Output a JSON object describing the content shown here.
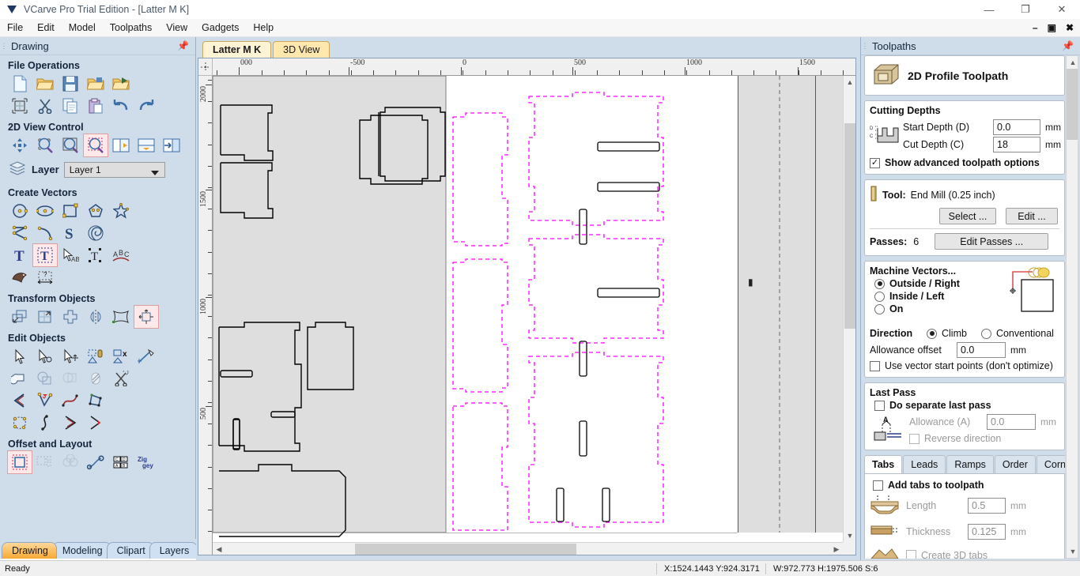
{
  "window": {
    "title": "VCarve Pro Trial Edition - [Latter M K]",
    "logo_icon": "vcarve-logo-icon",
    "minimize_label": "—",
    "maximize_label": "❐",
    "close_label": "✕",
    "mdi_minimize_label": "–",
    "mdi_restore_label": "❐",
    "mdi_close_label": "✖"
  },
  "menu": {
    "items": [
      {
        "label": "File",
        "name": "menu-file"
      },
      {
        "label": "Edit",
        "name": "menu-edit"
      },
      {
        "label": "Model",
        "name": "menu-model"
      },
      {
        "label": "Toolpaths",
        "name": "menu-toolpaths"
      },
      {
        "label": "View",
        "name": "menu-view"
      },
      {
        "label": "Gadgets",
        "name": "menu-gadgets"
      },
      {
        "label": "Help",
        "name": "menu-help"
      }
    ]
  },
  "drawing_panel": {
    "title": "Drawing",
    "pin_icon": "pin-icon",
    "groups": [
      {
        "title": "File Operations"
      },
      {
        "title": "2D View Control"
      },
      {
        "title": "Create Vectors"
      },
      {
        "title": "Transform Objects"
      },
      {
        "title": "Edit Objects"
      },
      {
        "title": "Offset and Layout"
      }
    ],
    "layer": {
      "label": "Layer",
      "value": "Layer 1",
      "icon": "layers-icon"
    },
    "tabs": [
      {
        "label": "Drawing",
        "active": true
      },
      {
        "label": "Modeling",
        "active": false
      },
      {
        "label": "Clipart",
        "active": false
      },
      {
        "label": "Layers",
        "active": false
      }
    ]
  },
  "canvas": {
    "tabs": [
      {
        "label": "Latter M K",
        "active": true
      },
      {
        "label": "3D View",
        "active": false
      }
    ],
    "h_ruler_labels": [
      "000",
      "-500",
      "0",
      "500",
      "1000",
      "1500"
    ],
    "v_ruler_labels": [
      "2000",
      "1500",
      "1000",
      "500"
    ],
    "material_fill": "#dedede",
    "vector_color": "#000000",
    "toolpath_color": "#ff00ff"
  },
  "toolpaths_panel": {
    "title": "Toolpaths",
    "pin_icon": "pin-icon",
    "header": {
      "label": "2D Profile Toolpath",
      "icon": "profile-toolpath-icon"
    },
    "cutting_depths": {
      "title": "Cutting Depths",
      "icon": "cut-depth-diagram-icon",
      "start_depth_label": "Start Depth (D)",
      "start_depth_value": "0.0",
      "start_depth_unit": "mm",
      "cut_depth_label": "Cut Depth (C)",
      "cut_depth_value": "18",
      "cut_depth_unit": "mm",
      "advanced_label": "Show advanced toolpath options",
      "advanced_checked": true
    },
    "tool": {
      "icon": "endmill-icon",
      "label": "Tool:",
      "value": "End Mill (0.25 inch)",
      "select_label": "Select ...",
      "edit_label": "Edit ...",
      "passes_label": "Passes:",
      "passes_value": "6",
      "edit_passes_label": "Edit Passes ..."
    },
    "machine_vectors": {
      "title": "Machine Vectors...",
      "icon": "machine-vectors-diagram-icon",
      "options": [
        {
          "label": "Outside / Right",
          "selected": true
        },
        {
          "label": "Inside / Left",
          "selected": false
        },
        {
          "label": "On",
          "selected": false
        }
      ],
      "direction_label": "Direction",
      "direction_options": [
        {
          "label": "Climb",
          "selected": true
        },
        {
          "label": "Conventional",
          "selected": false
        }
      ],
      "allowance_label": "Allowance offset",
      "allowance_value": "0.0",
      "allowance_unit": "mm",
      "start_points_label": "Use vector start points (don't optimize)",
      "start_points_checked": false
    },
    "last_pass": {
      "title": "Last Pass",
      "icon": "last-pass-diagram-icon",
      "separate_label": "Do separate last pass",
      "separate_checked": false,
      "allowance_label": "Allowance (A)",
      "allowance_value": "0.0",
      "allowance_unit": "mm",
      "reverse_label": "Reverse direction",
      "reverse_checked": false
    },
    "tabs_section": {
      "tabs": [
        {
          "label": "Tabs",
          "active": true
        },
        {
          "label": "Leads",
          "active": false
        },
        {
          "label": "Ramps",
          "active": false
        },
        {
          "label": "Order",
          "active": false
        },
        {
          "label": "Corners",
          "active": false
        }
      ],
      "add_tabs_label": "Add tabs to toolpath",
      "add_tabs_checked": false,
      "length_label": "Length",
      "length_value": "0.5",
      "length_unit": "mm",
      "length_icon": "tab-length-icon",
      "thickness_label": "Thickness",
      "thickness_value": "0.125",
      "thickness_unit": "mm",
      "thickness_icon": "tab-thickness-icon",
      "create_3d_label": "Create 3D tabs",
      "create_3d_checked": false,
      "create_3d_icon": "tab-3d-icon"
    }
  },
  "statusbar": {
    "ready": "Ready",
    "coords": "X:1524.1443 Y:924.3171",
    "dimensions": "W:972.773  H:1975.506  S:6"
  }
}
